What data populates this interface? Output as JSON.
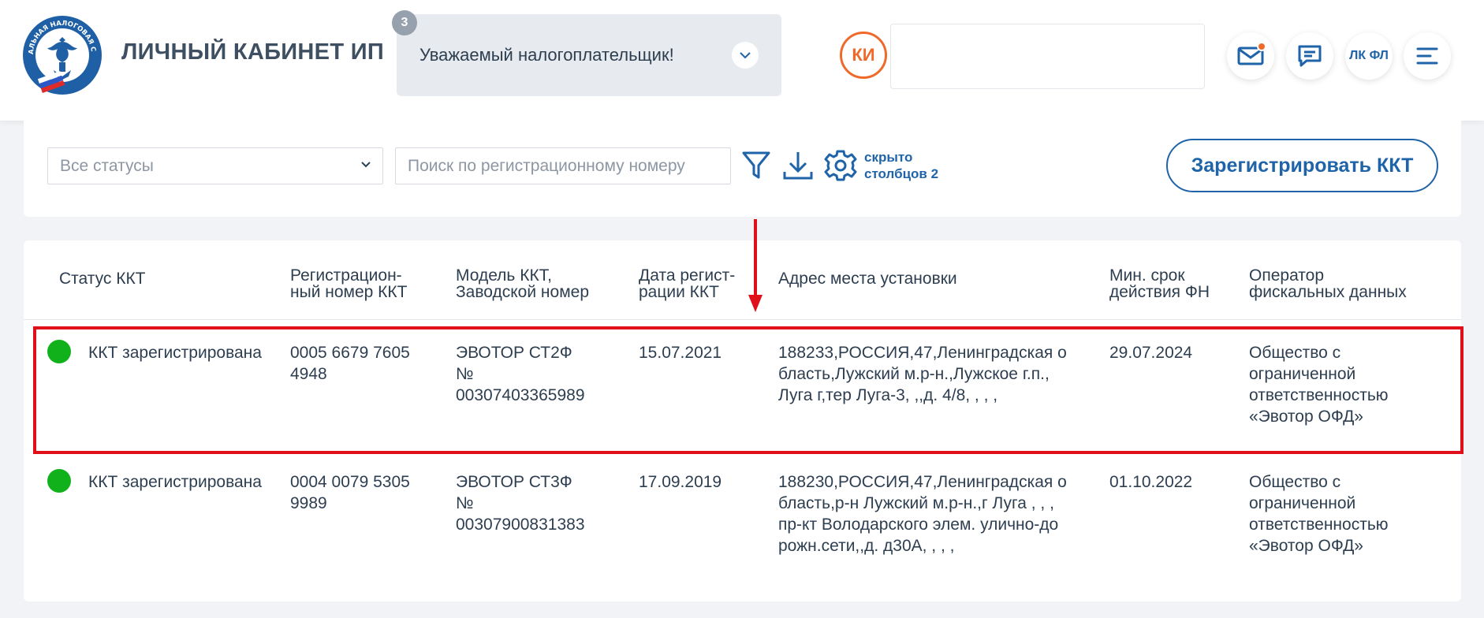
{
  "header": {
    "logo_text": "ФЕДЕРАЛЬНАЯ НАЛОГОВАЯ СЛУЖБА",
    "brand": "ЛИЧНЫЙ КАБИНЕТ ИП",
    "notice": {
      "count": "3",
      "text": "Уважаемый налогоплательщик!"
    },
    "avatar_initials": "КИ",
    "user_name": "",
    "lk_fl_label": "ЛК ФЛ",
    "icons": [
      "mail-icon",
      "chat-icon",
      "menu-icon"
    ]
  },
  "filters": {
    "status_select": "Все статусы",
    "search_placeholder": "Поиск по регистрационному номеру",
    "hidden_columns_line1": "скрыто",
    "hidden_columns_line2": "столбцов 2",
    "register_button": "Зарегистрировать ККТ"
  },
  "table": {
    "columns": [
      [
        "Статус ККТ"
      ],
      [
        "Регистрацион-",
        "ный номер ККТ"
      ],
      [
        "Модель ККТ,",
        "Заводской номер"
      ],
      [
        "Дата регист-",
        "рации ККТ"
      ],
      [
        "Адрес места установки"
      ],
      [
        "Мин. срок",
        "действия ФН"
      ],
      [
        "Оператор",
        "фискальных данных"
      ]
    ],
    "rows": [
      {
        "status": "ККТ зарегистрирована",
        "status_color": "#11b11b",
        "reg_number": [
          "0005 6679 7605",
          "4948"
        ],
        "model": [
          "ЭВОТОР СТ2Ф",
          "№",
          "00307403365989"
        ],
        "reg_date": "15.07.2021",
        "address": [
          "188233,РОССИЯ,47,Ленинградская о",
          "бласть,Лужский м.р-н.,Лужское г.п.,",
          "Луга г,тер Луга-3, ,,д. 4/8, , , ,"
        ],
        "fn_date": "29.07.2024",
        "ofd": [
          "Общество с",
          "ограниченной",
          "ответственностью",
          "«Эвотор ОФД»"
        ]
      },
      {
        "status": "ККТ зарегистрирована",
        "status_color": "#11b11b",
        "reg_number": [
          "0004 0079 5305",
          "9989"
        ],
        "model": [
          "ЭВОТОР СТ3Ф",
          "№",
          "00307900831383"
        ],
        "reg_date": "17.09.2019",
        "address": [
          "188230,РОССИЯ,47,Ленинградская о",
          "бласть,р-н Лужский м.р-н.,г Луга , , ,",
          "пр-кт Володарского элем. улично-до",
          "рожн.сети,,д. д30А, , , ,"
        ],
        "fn_date": "01.10.2022",
        "ofd": [
          "Общество с",
          "ограниченной",
          "ответственностью",
          "«Эвотор ОФД»"
        ]
      }
    ]
  },
  "colors": {
    "accent": "#1f64a8",
    "avatar": "#ef6a2a",
    "highlight": "#e0101a",
    "status_ok": "#11b11b"
  }
}
